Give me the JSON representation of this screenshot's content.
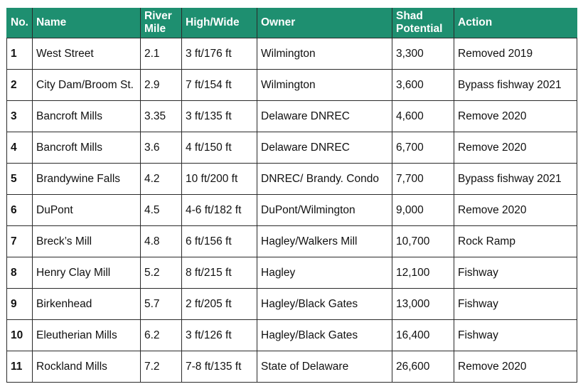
{
  "colors": {
    "header_background": "#1e8f70",
    "header_text": "#ffffff",
    "grid_lines": "#2a2a2a"
  },
  "table": {
    "headers": [
      "No.",
      "Name",
      "River Mile",
      "High/Wide",
      "Owner",
      "Shad Potential",
      "Action"
    ],
    "rows": [
      [
        "1",
        "West Street",
        "2.1",
        "3 ft/176 ft",
        "Wilmington",
        "3,300",
        "Removed 2019"
      ],
      [
        "2",
        "City Dam/Broom St.",
        "2.9",
        "7 ft/154 ft",
        "Wilmington",
        "3,600",
        "Bypass fishway 2021"
      ],
      [
        "3",
        "Bancroft Mills",
        "3.35",
        "3 ft/135 ft",
        "Delaware DNREC",
        "4,600",
        "Remove 2020"
      ],
      [
        "4",
        "Bancroft Mills",
        "3.6",
        "4 ft/150 ft",
        "Delaware DNREC",
        "6,700",
        "Remove 2020"
      ],
      [
        "5",
        "Brandywine Falls",
        "4.2",
        "10 ft/200 ft",
        "DNREC/ Brandy. Condo",
        "7,700",
        "Bypass fishway 2021"
      ],
      [
        "6",
        "DuPont",
        "4.5",
        "4-6 ft/182 ft",
        "DuPont/Wilmington",
        "9,000",
        "Remove 2020"
      ],
      [
        "7",
        "Breck’s Mill",
        "4.8",
        "6 ft/156 ft",
        "Hagley/Walkers Mill",
        "10,700",
        "Rock Ramp"
      ],
      [
        "8",
        "Henry Clay Mill",
        "5.2",
        "8 ft/215 ft",
        "Hagley",
        "12,100",
        "Fishway"
      ],
      [
        "9",
        "Birkenhead",
        "5.7",
        "2 ft/205 ft",
        "Hagley/Black Gates",
        "13,000",
        "Fishway"
      ],
      [
        "10",
        "Eleutherian Mills",
        "6.2",
        "3 ft/126 ft",
        "Hagley/Black Gates",
        "16,400",
        "Fishway"
      ],
      [
        "11",
        "Rockland Mills",
        "7.2",
        "7-8 ft/135 ft",
        "State of Delaware",
        "26,600",
        "Remove 2020"
      ]
    ]
  }
}
